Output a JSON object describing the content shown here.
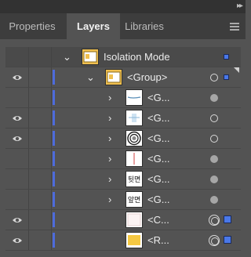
{
  "tabs": [
    {
      "label": "Properties",
      "active": false
    },
    {
      "label": "Layers",
      "active": true
    },
    {
      "label": "Libraries",
      "active": false
    }
  ],
  "icons": {
    "collapse": "double-chevron-right-icon",
    "menu": "hamburger-menu-icon"
  },
  "colors": {
    "layer_color": "#4d6bdb",
    "selection_square": "#4a78e8",
    "group_thumbnail": "#f0c050"
  },
  "layers": {
    "isolation": {
      "label": "Isolation Mode"
    },
    "group": {
      "label": "<Group>",
      "visible": true
    },
    "items": [
      {
        "label": "<G...",
        "visible": false
      },
      {
        "label": "<G...",
        "visible": true
      },
      {
        "label": "<G...",
        "visible": true
      },
      {
        "label": "<G...",
        "visible": false
      },
      {
        "label": "<G...",
        "visible": false
      },
      {
        "label": "<G...",
        "visible": false
      },
      {
        "label": "<C...",
        "visible": true
      },
      {
        "label": "<R...",
        "visible": true
      }
    ],
    "thumb_text": {
      "item4": "뒷면",
      "item5": "앞면"
    }
  }
}
